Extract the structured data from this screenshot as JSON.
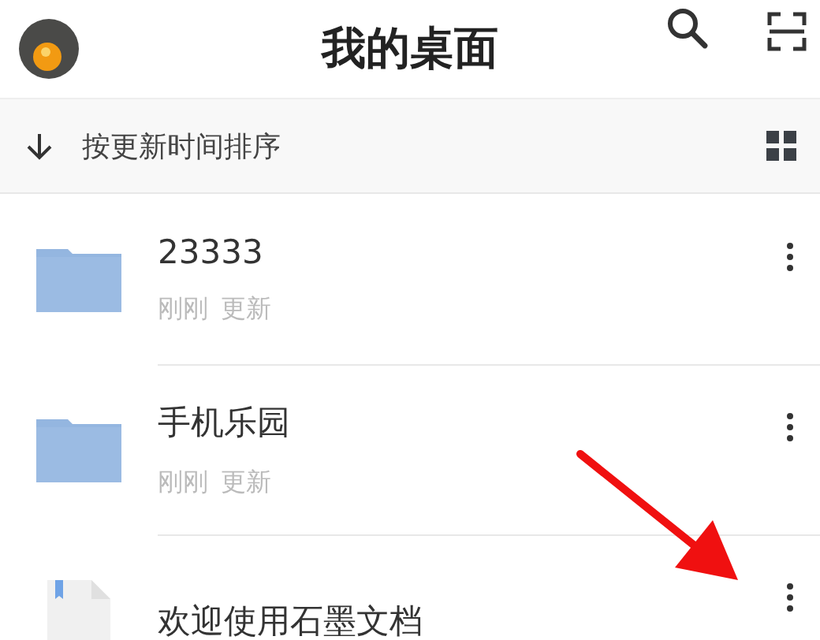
{
  "header": {
    "title": "我的桌面"
  },
  "sort_bar": {
    "label": "按更新时间排序"
  },
  "items": [
    {
      "kind": "folder",
      "name": "23333",
      "time": "刚刚",
      "status": "更新"
    },
    {
      "kind": "folder",
      "name": "手机乐园",
      "time": "刚刚",
      "status": "更新"
    },
    {
      "kind": "document",
      "name": "欢迎使用石墨文档"
    }
  ]
}
